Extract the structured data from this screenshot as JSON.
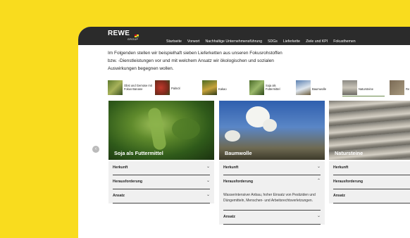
{
  "brand": {
    "name": "REWE",
    "sub": "GROUP",
    "colors": {
      "background": "#f9dc1e",
      "topbar": "#2b2b2b",
      "accent_red": "#cc071e",
      "accent_yellow": "#f9dc1e"
    }
  },
  "nav": {
    "items": [
      "Startseite",
      "Vorwort",
      "Nachhaltige Unternehmensführung",
      "SDGs",
      "Lieferkette",
      "Ziele und KPI",
      "Fokusthemen"
    ]
  },
  "intro": {
    "text": "Im Folgenden stellen wir beispielhaft sieben Lieferketten aus unseren Fokusrohstoffen bzw. -Dienstleistungen vor und mit welchem Ansatz wir ökologischen und sozialen Auswirkungen begegnen wollen."
  },
  "tiles": [
    {
      "label": "Obst und Gemüse mit Fokus Banane"
    },
    {
      "label": "Palmöl"
    },
    {
      "label": "Kakao"
    },
    {
      "label": "Soja als Futtermittel"
    },
    {
      "label": "Baumwolle"
    },
    {
      "label": "Natursteine"
    },
    {
      "label": "Re"
    }
  ],
  "carousel": {
    "prev_icon": "chevron-left-icon"
  },
  "cards": [
    {
      "title": "Soja als Futtermittel",
      "rows": [
        {
          "label": "Herkunft",
          "open": false
        },
        {
          "label": "Herausforderung",
          "open": false
        },
        {
          "label": "Ansatz",
          "open": false
        }
      ]
    },
    {
      "title": "Baumwolle",
      "rows": [
        {
          "label": "Herkunft",
          "open": false
        },
        {
          "label": "Herausforderung",
          "open": true,
          "body": "Wasserintensiver Anbau, hoher Einsatz von Pestiziden und Düngemitteln, Menschen- und Arbeitsrechtsverletzungen."
        },
        {
          "label": "Ansatz",
          "open": false
        }
      ]
    },
    {
      "title": "Natursteine",
      "rows": [
        {
          "label": "Herkunft",
          "open": false
        },
        {
          "label": "Herausforderung",
          "open": false
        },
        {
          "label": "Ansatz",
          "open": false
        }
      ]
    }
  ]
}
